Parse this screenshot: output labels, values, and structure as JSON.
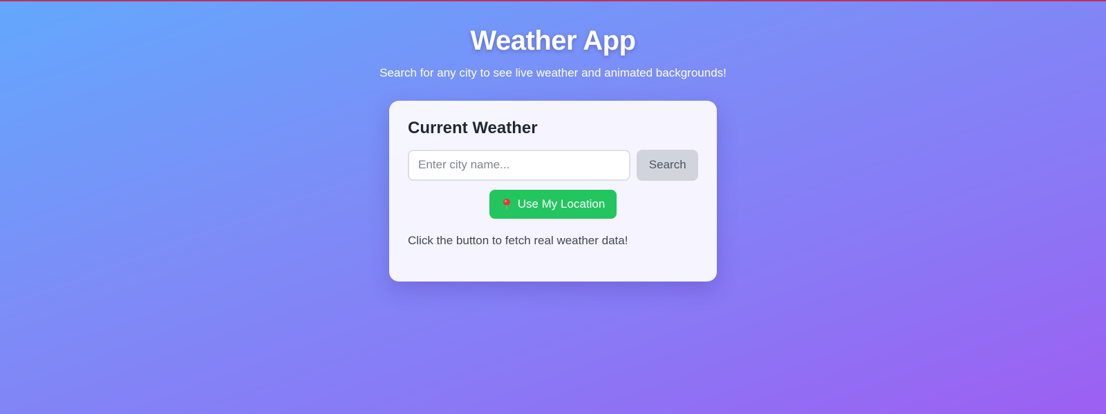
{
  "header": {
    "title": "Weather App",
    "subtitle": "Search for any city to see live weather and animated backgrounds!"
  },
  "card": {
    "title": "Current Weather",
    "search": {
      "placeholder": "Enter city name...",
      "value": "",
      "button_label": "Search"
    },
    "location_button": {
      "icon": "pin-icon",
      "label": "Use My Location"
    },
    "status_text": "Click the button to fetch real weather data!"
  },
  "colors": {
    "gradient_start": "#63a8fd",
    "gradient_end": "#9d5ff2",
    "location_button": "#22c55e",
    "search_button": "#d1d5db",
    "top_border": "#c0305c"
  }
}
